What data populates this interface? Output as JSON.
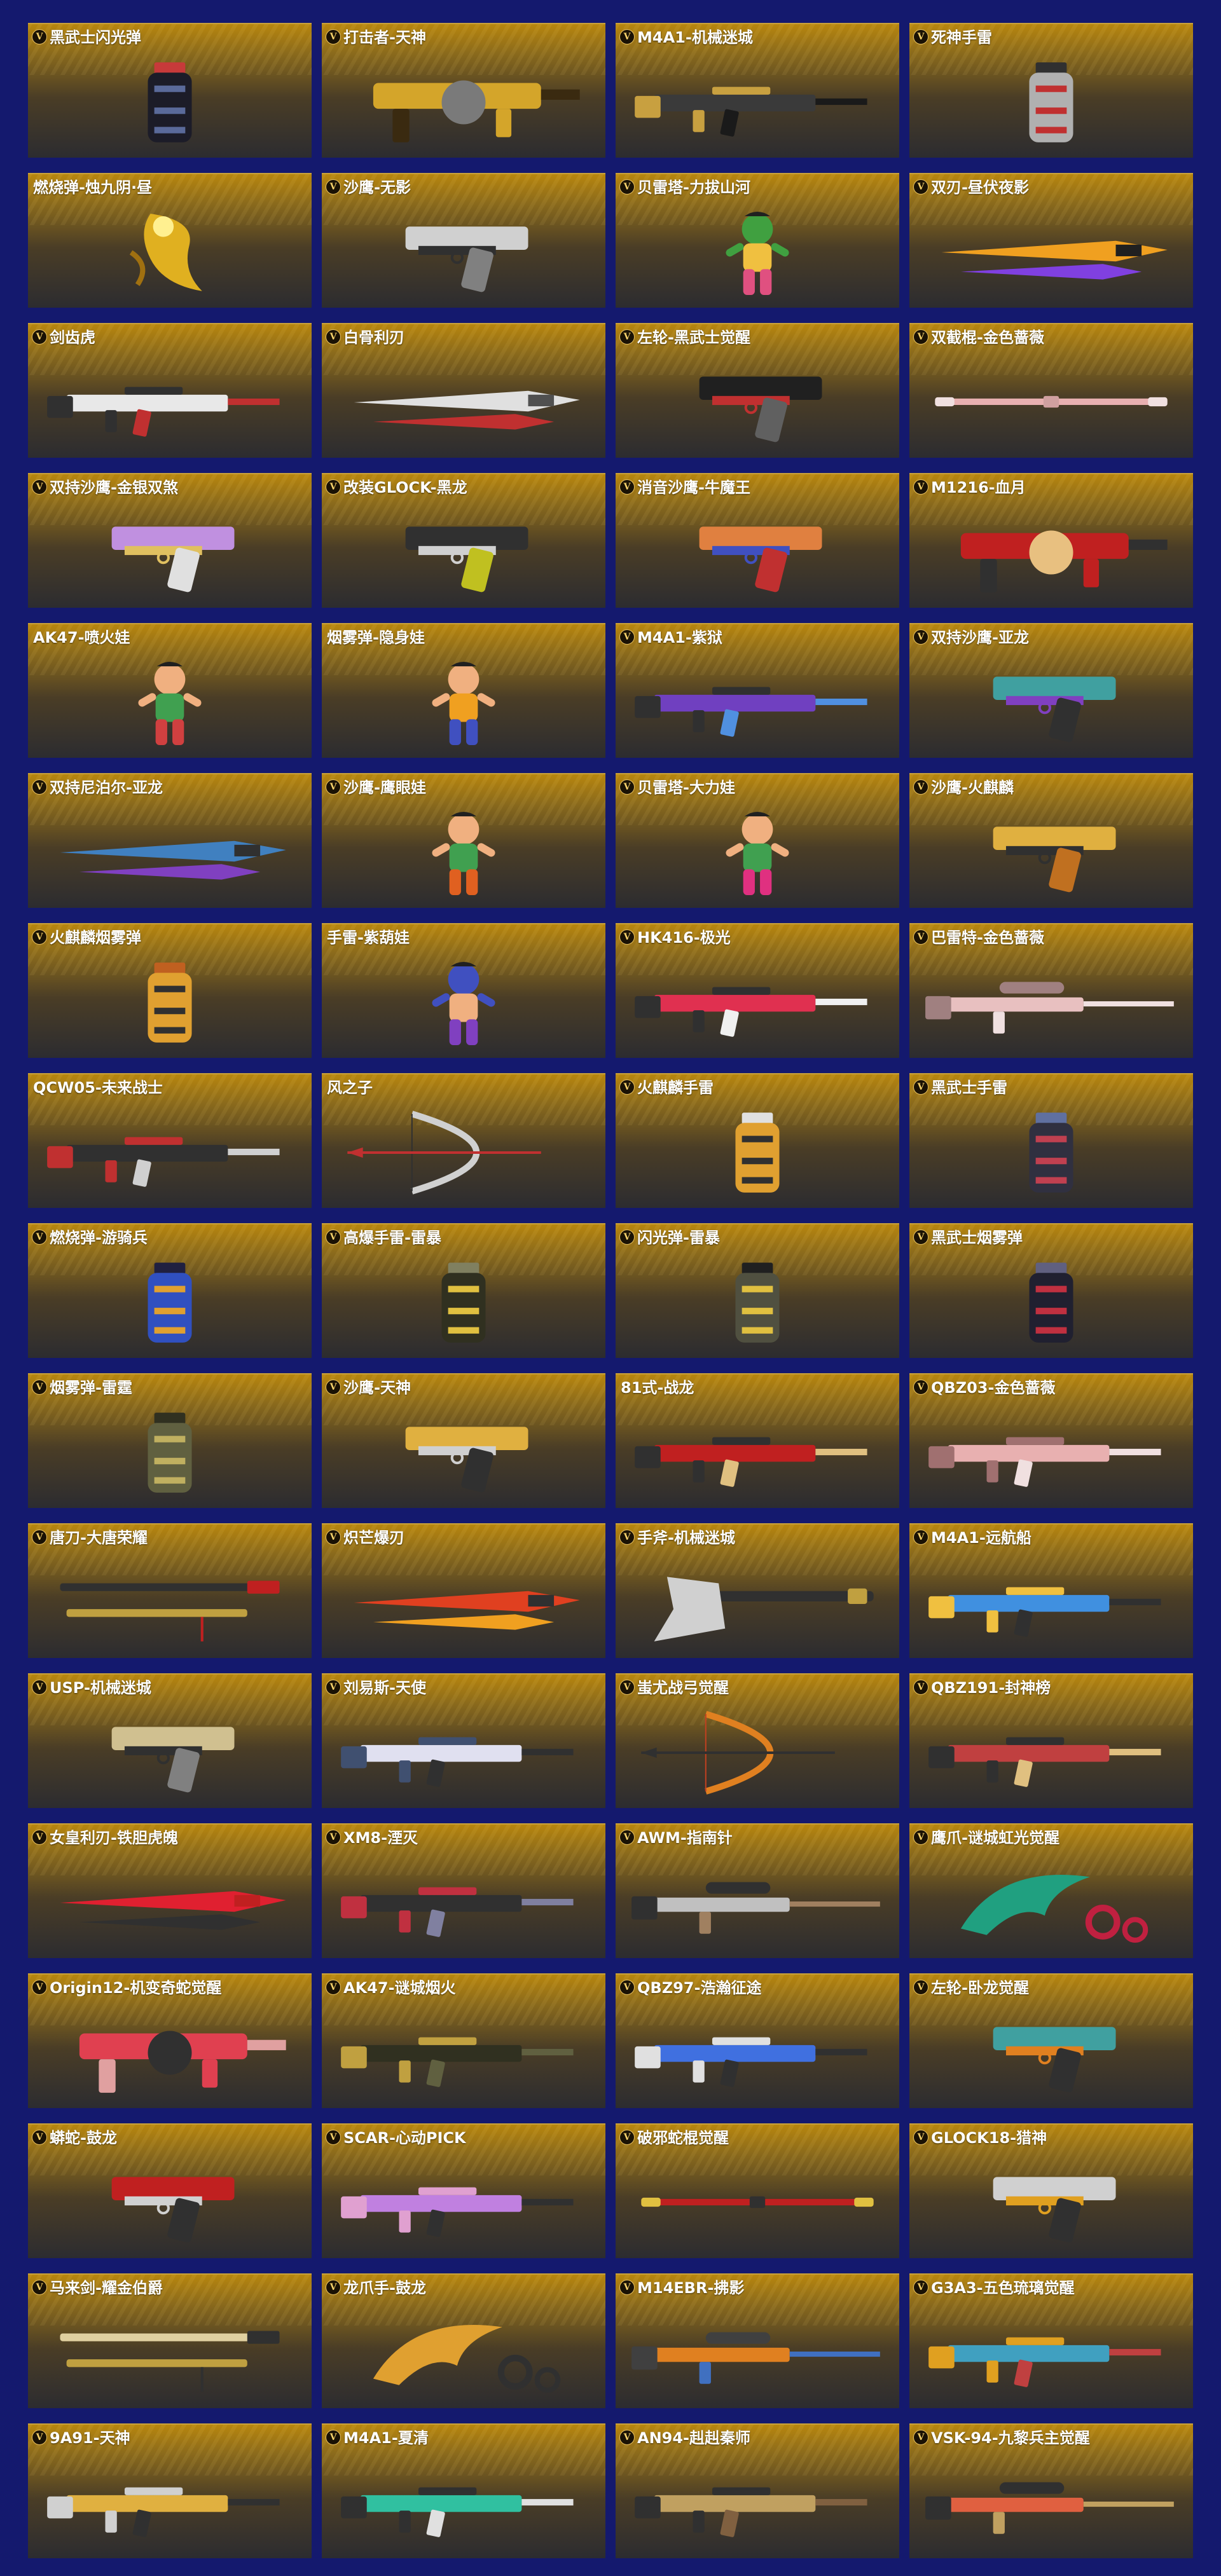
{
  "badge_glyph": "V",
  "cards": [
    {
      "title": "黑武士闪光弹",
      "badge": true,
      "icon": "grenade-icon",
      "palette": [
        "#1c1c28",
        "#5a6a9a",
        "#c73a3a"
      ]
    },
    {
      "title": "打击者-天神",
      "badge": true,
      "icon": "shotgun-icon",
      "palette": [
        "#d4a52a",
        "#7a7a7a",
        "#3a2a10"
      ]
    },
    {
      "title": "M4A1-机械迷城",
      "badge": true,
      "icon": "rifle-icon",
      "palette": [
        "#3a3a3a",
        "#c8a040",
        "#1a1a1a"
      ]
    },
    {
      "title": "死神手雷",
      "badge": true,
      "icon": "grenade-icon",
      "palette": [
        "#b0b0b0",
        "#c03030",
        "#303030"
      ]
    },
    {
      "title": "燃烧弹-烛九阴·昼",
      "badge": false,
      "icon": "dragon-icon",
      "palette": [
        "#e0b020",
        "#a07010",
        "#fff090"
      ]
    },
    {
      "title": "沙鹰-无影",
      "badge": true,
      "icon": "pistol-icon",
      "palette": [
        "#d0d0d0",
        "#303030",
        "#808080"
      ]
    },
    {
      "title": "贝雷塔-力拔山河",
      "badge": true,
      "icon": "character-icon",
      "palette": [
        "#e05080",
        "#f0c040",
        "#40a040"
      ]
    },
    {
      "title": "双刃-昼伏夜影",
      "badge": true,
      "icon": "blade-icon",
      "palette": [
        "#f0a020",
        "#8040e0",
        "#202020"
      ]
    },
    {
      "title": "剑齿虎",
      "badge": true,
      "icon": "rifle-icon",
      "palette": [
        "#e8e8e8",
        "#303030",
        "#c03030"
      ]
    },
    {
      "title": "白骨利刃",
      "badge": true,
      "icon": "blade-icon",
      "palette": [
        "#e0e0e0",
        "#c03030",
        "#505050"
      ]
    },
    {
      "title": "左轮-黑武士觉醒",
      "badge": true,
      "icon": "pistol-icon",
      "palette": [
        "#202020",
        "#c03030",
        "#606060"
      ]
    },
    {
      "title": "双截棍-金色蔷薇",
      "badge": true,
      "icon": "staff-icon",
      "palette": [
        "#e8b0b0",
        "#d0a0a0",
        "#f0e0e0"
      ]
    },
    {
      "title": "双持沙鹰-金银双煞",
      "badge": true,
      "icon": "pistol-icon",
      "palette": [
        "#c090e0",
        "#e0c060",
        "#e0e0e0"
      ]
    },
    {
      "title": "改装GLOCK-黑龙",
      "badge": true,
      "icon": "pistol-icon",
      "palette": [
        "#303030",
        "#d0d0d0",
        "#c0c020"
      ]
    },
    {
      "title": "消音沙鹰-牛魔王",
      "badge": true,
      "icon": "pistol-icon",
      "palette": [
        "#e08040",
        "#4050c0",
        "#c03030"
      ]
    },
    {
      "title": "M1216-血月",
      "badge": true,
      "icon": "shotgun-icon",
      "palette": [
        "#c02020",
        "#e8c080",
        "#303030"
      ]
    },
    {
      "title": "AK47-喷火娃",
      "badge": false,
      "icon": "character-icon",
      "palette": [
        "#d04040",
        "#40a050",
        "#f0b080"
      ]
    },
    {
      "title": "烟雾弹-隐身娃",
      "badge": false,
      "icon": "character-icon",
      "palette": [
        "#4050c0",
        "#f0a020",
        "#f0b080"
      ]
    },
    {
      "title": "M4A1-紫狱",
      "badge": true,
      "icon": "rifle-icon",
      "palette": [
        "#7040c0",
        "#303030",
        "#5090e0"
      ]
    },
    {
      "title": "双持沙鹰-亚龙",
      "badge": true,
      "icon": "pistol-icon",
      "palette": [
        "#40a0a0",
        "#8040c0",
        "#303030"
      ]
    },
    {
      "title": "双持尼泊尔-亚龙",
      "badge": true,
      "icon": "blade-icon",
      "palette": [
        "#4080c0",
        "#8040c0",
        "#303030"
      ]
    },
    {
      "title": "沙鹰-鹰眼娃",
      "badge": true,
      "icon": "character-icon",
      "palette": [
        "#e06020",
        "#40a050",
        "#f0b080"
      ]
    },
    {
      "title": "贝雷塔-大力娃",
      "badge": true,
      "icon": "character-icon",
      "palette": [
        "#e03080",
        "#40a050",
        "#f0b080"
      ]
    },
    {
      "title": "沙鹰-火麒麟",
      "badge": true,
      "icon": "pistol-icon",
      "palette": [
        "#e0b040",
        "#303030",
        "#c07020"
      ]
    },
    {
      "title": "火麒麟烟雾弹",
      "badge": true,
      "icon": "grenade-icon",
      "palette": [
        "#e0a030",
        "#303030",
        "#c06020"
      ]
    },
    {
      "title": "手雷-紫葫娃",
      "badge": false,
      "icon": "character-icon",
      "palette": [
        "#8040c0",
        "#f0b080",
        "#4050c0"
      ]
    },
    {
      "title": "HK416-极光",
      "badge": true,
      "icon": "rifle-icon",
      "palette": [
        "#e03050",
        "#303030",
        "#f0f0f0"
      ]
    },
    {
      "title": "巴雷特-金色蔷薇",
      "badge": true,
      "icon": "sniper-icon",
      "palette": [
        "#e8c0c0",
        "#a08080",
        "#f0e0e0"
      ]
    },
    {
      "title": "QCW05-未来战士",
      "badge": false,
      "icon": "rifle-icon",
      "palette": [
        "#303030",
        "#c03030",
        "#d0d0d0"
      ]
    },
    {
      "title": "风之子",
      "badge": false,
      "icon": "bow-icon",
      "palette": [
        "#d0d0d0",
        "#303030",
        "#c03030"
      ]
    },
    {
      "title": "火麒麟手雷",
      "badge": true,
      "icon": "grenade-icon",
      "palette": [
        "#e0a030",
        "#303030",
        "#e0e0e0"
      ]
    },
    {
      "title": "黑武士手雷",
      "badge": true,
      "icon": "grenade-icon",
      "palette": [
        "#303040",
        "#c04050",
        "#6070a0"
      ]
    },
    {
      "title": "燃烧弹-游骑兵",
      "badge": true,
      "icon": "grenade-icon",
      "palette": [
        "#3050c0",
        "#e0a030",
        "#202040"
      ]
    },
    {
      "title": "高爆手雷-雷暴",
      "badge": true,
      "icon": "grenade-icon",
      "palette": [
        "#303020",
        "#e0c040",
        "#808060"
      ]
    },
    {
      "title": "闪光弹-雷暴",
      "badge": true,
      "icon": "grenade-icon",
      "palette": [
        "#505040",
        "#e0c040",
        "#202020"
      ]
    },
    {
      "title": "黑武士烟雾弹",
      "badge": true,
      "icon": "grenade-icon",
      "palette": [
        "#202030",
        "#c03040",
        "#606080"
      ]
    },
    {
      "title": "烟雾弹-雷霆",
      "badge": true,
      "icon": "grenade-icon",
      "palette": [
        "#606040",
        "#c0b060",
        "#303020"
      ]
    },
    {
      "title": "沙鹰-天神",
      "badge": true,
      "icon": "pistol-icon",
      "palette": [
        "#e0b040",
        "#d0d0d0",
        "#303030"
      ]
    },
    {
      "title": "81式-战龙",
      "badge": false,
      "icon": "rifle-icon",
      "palette": [
        "#c02020",
        "#303030",
        "#e0c080"
      ]
    },
    {
      "title": "QBZ03-金色蔷薇",
      "badge": true,
      "icon": "rifle-icon",
      "palette": [
        "#e8b0b0",
        "#a07070",
        "#f0e0e0"
      ]
    },
    {
      "title": "唐刀-大唐荣耀",
      "badge": true,
      "icon": "sword-icon",
      "palette": [
        "#303030",
        "#c0a040",
        "#c02020"
      ]
    },
    {
      "title": "炽芒爆刃",
      "badge": true,
      "icon": "blade-icon",
      "palette": [
        "#e04020",
        "#f0a020",
        "#303030"
      ]
    },
    {
      "title": "手斧-机械迷城",
      "badge": true,
      "icon": "axe-icon",
      "palette": [
        "#d0d0d0",
        "#303030",
        "#c0a040"
      ]
    },
    {
      "title": "M4A1-远航船",
      "badge": true,
      "icon": "rifle-icon",
      "palette": [
        "#4090e0",
        "#f0c040",
        "#303030"
      ]
    },
    {
      "title": "USP-机械迷城",
      "badge": true,
      "icon": "pistol-icon",
      "palette": [
        "#d0c090",
        "#303030",
        "#808080"
      ]
    },
    {
      "title": "刘易斯-天使",
      "badge": true,
      "icon": "rifle-icon",
      "palette": [
        "#e0e0f0",
        "#405070",
        "#303030"
      ]
    },
    {
      "title": "蚩尤战弓觉醒",
      "badge": true,
      "icon": "bow-icon",
      "palette": [
        "#e08020",
        "#c04020",
        "#303030"
      ]
    },
    {
      "title": "QBZ191-封神榜",
      "badge": true,
      "icon": "rifle-icon",
      "palette": [
        "#c04040",
        "#303030",
        "#e0c080"
      ]
    },
    {
      "title": "女皇利刃-铁胆虎魄",
      "badge": true,
      "icon": "blade-icon",
      "palette": [
        "#e02030",
        "#303030",
        "#c02020"
      ]
    },
    {
      "title": "XM8-湮灭",
      "badge": true,
      "icon": "rifle-icon",
      "palette": [
        "#303030",
        "#c03040",
        "#8080a0"
      ]
    },
    {
      "title": "AWM-指南针",
      "badge": true,
      "icon": "sniper-icon",
      "palette": [
        "#c0c0c0",
        "#303030",
        "#a08060"
      ]
    },
    {
      "title": "鹰爪-谜城虹光觉醒",
      "badge": true,
      "icon": "claw-icon",
      "palette": [
        "#20a080",
        "#c02040",
        "#e0e0e0"
      ]
    },
    {
      "title": "Origin12-机变奇蛇觉醒",
      "badge": true,
      "icon": "shotgun-icon",
      "palette": [
        "#e04050",
        "#303030",
        "#e0a0a0"
      ]
    },
    {
      "title": "AK47-谜城烟火",
      "badge": true,
      "icon": "rifle-icon",
      "palette": [
        "#303020",
        "#c0a040",
        "#606040"
      ]
    },
    {
      "title": "QBZ97-浩瀚征途",
      "badge": true,
      "icon": "rifle-icon",
      "palette": [
        "#4070e0",
        "#e0e0e0",
        "#303030"
      ]
    },
    {
      "title": "左轮-卧龙觉醒",
      "badge": true,
      "icon": "pistol-icon",
      "palette": [
        "#40a0a0",
        "#e08020",
        "#303030"
      ]
    },
    {
      "title": "蟒蛇-鼓龙",
      "badge": true,
      "icon": "pistol-icon",
      "palette": [
        "#c02020",
        "#d0d0d0",
        "#303030"
      ]
    },
    {
      "title": "SCAR-心动PICK",
      "badge": true,
      "icon": "rifle-icon",
      "palette": [
        "#c080e0",
        "#e0a0d0",
        "#303030"
      ]
    },
    {
      "title": "破邪蛇棍觉醒",
      "badge": true,
      "icon": "staff-icon",
      "palette": [
        "#c02020",
        "#303030",
        "#e0c040"
      ]
    },
    {
      "title": "GLOCK18-猎神",
      "badge": true,
      "icon": "pistol-icon",
      "palette": [
        "#d0d0d0",
        "#e0a020",
        "#303030"
      ]
    },
    {
      "title": "马来剑-耀金伯爵",
      "badge": true,
      "icon": "sword-icon",
      "palette": [
        "#e0d0a0",
        "#c0a040",
        "#303030"
      ]
    },
    {
      "title": "龙爪手-鼓龙",
      "badge": true,
      "icon": "claw-icon",
      "palette": [
        "#e0a030",
        "#303030",
        "#c02020"
      ]
    },
    {
      "title": "M14EBR-拂影",
      "badge": true,
      "icon": "sniper-icon",
      "palette": [
        "#e08020",
        "#404040",
        "#4070c0"
      ]
    },
    {
      "title": "G3A3-五色琉璃觉醒",
      "badge": true,
      "icon": "rifle-icon",
      "palette": [
        "#40a0c0",
        "#e0a020",
        "#c04040"
      ]
    },
    {
      "title": "9A91-天神",
      "badge": true,
      "icon": "rifle-icon",
      "palette": [
        "#e0b040",
        "#d0d0d0",
        "#303030"
      ]
    },
    {
      "title": "M4A1-夏清",
      "badge": true,
      "icon": "rifle-icon",
      "palette": [
        "#30c0a0",
        "#303030",
        "#e0e0e0"
      ]
    },
    {
      "title": "AN94-赳赳秦师",
      "badge": true,
      "icon": "rifle-icon",
      "palette": [
        "#c0a060",
        "#303030",
        "#806040"
      ]
    },
    {
      "title": "VSK-94-九黎兵主觉醒",
      "badge": true,
      "icon": "sniper-icon",
      "palette": [
        "#e06040",
        "#303030",
        "#c0a060"
      ]
    }
  ]
}
